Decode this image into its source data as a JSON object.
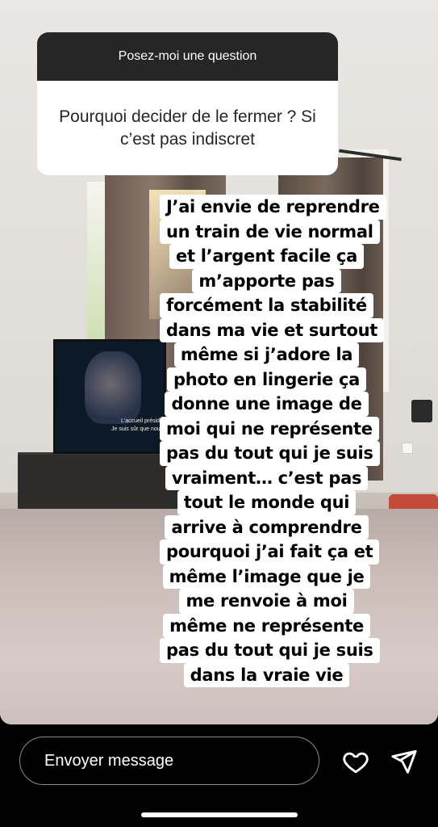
{
  "story": {
    "tv_subtitle_line1": "L'accueil préside",
    "tv_subtitle_line2": "Je suis sûr que nous"
  },
  "question_sticker": {
    "header": "Posez-moi une question",
    "question": "Pourquoi decider de le fermer ? Si c’est pas indiscret"
  },
  "answer": {
    "lines": [
      "J’ai envie de reprendre",
      "un train de vie normal",
      "et l’argent facile ça",
      "m’apporte pas",
      "forcément la stabilité",
      "dans ma vie et surtout",
      "même si j’adore la",
      "photo en lingerie ça",
      "donne une image de",
      "moi qui ne représente",
      "pas du tout qui je suis",
      "vraiment… c’est pas",
      "tout le monde qui",
      "arrive à comprendre",
      "pourquoi j’ai fait ça et",
      "même l’image que je",
      "me renvoie à moi",
      "même ne représente",
      "pas du tout qui je suis",
      "dans la vraie vie"
    ]
  },
  "reply_bar": {
    "placeholder": "Envoyer message",
    "icons": [
      "heart-icon",
      "send-icon"
    ]
  }
}
